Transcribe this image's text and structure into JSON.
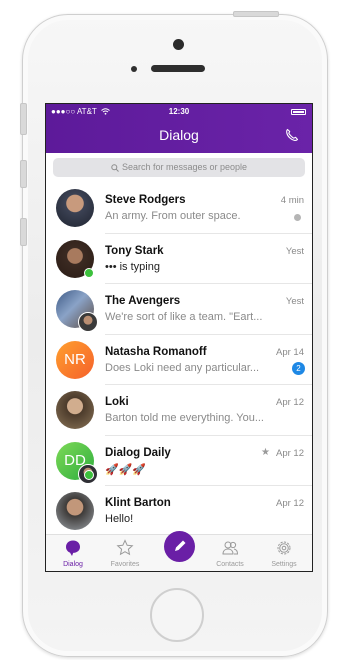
{
  "status_bar": {
    "carrier": "●●●○○ AT&T",
    "time": "12:30"
  },
  "header": {
    "title": "Dialog"
  },
  "search": {
    "placeholder": "Search for messages or people"
  },
  "conversations": [
    {
      "name": "Steve Rodgers",
      "preview": "An army. From outer space.",
      "time": "4 min",
      "indicator": "read-dot"
    },
    {
      "name": "Tony Stark",
      "preview": "••• is typing",
      "time": "Yest",
      "indicator": "online"
    },
    {
      "name": "The Avengers",
      "preview": "We're sort of like a team. \"Eart...",
      "time": "Yest"
    },
    {
      "name": "Natasha Romanoff",
      "initials": "NR",
      "preview": "Does Loki need any particular...",
      "time": "Apr 14",
      "unread": "2"
    },
    {
      "name": "Loki",
      "preview": "Barton told me everything. You...",
      "time": "Apr 12"
    },
    {
      "name": "Dialog Daily",
      "initials": "DD",
      "preview": "🚀🚀🚀",
      "time": "Apr 12",
      "starred": true
    },
    {
      "name": "Klint Barton",
      "preview": "Hello!",
      "time": "Apr 12"
    }
  ],
  "tabs": [
    {
      "label": "Dialog",
      "icon": "chat-bubble-icon",
      "active": true
    },
    {
      "label": "Favorites",
      "icon": "star-icon"
    },
    {
      "label": "",
      "icon": "compose-icon"
    },
    {
      "label": "Contacts",
      "icon": "contacts-icon"
    },
    {
      "label": "Settings",
      "icon": "gear-icon"
    }
  ],
  "colors": {
    "accent": "#6a1fa6",
    "online": "#3cc03c",
    "badge": "#1e88e5"
  }
}
